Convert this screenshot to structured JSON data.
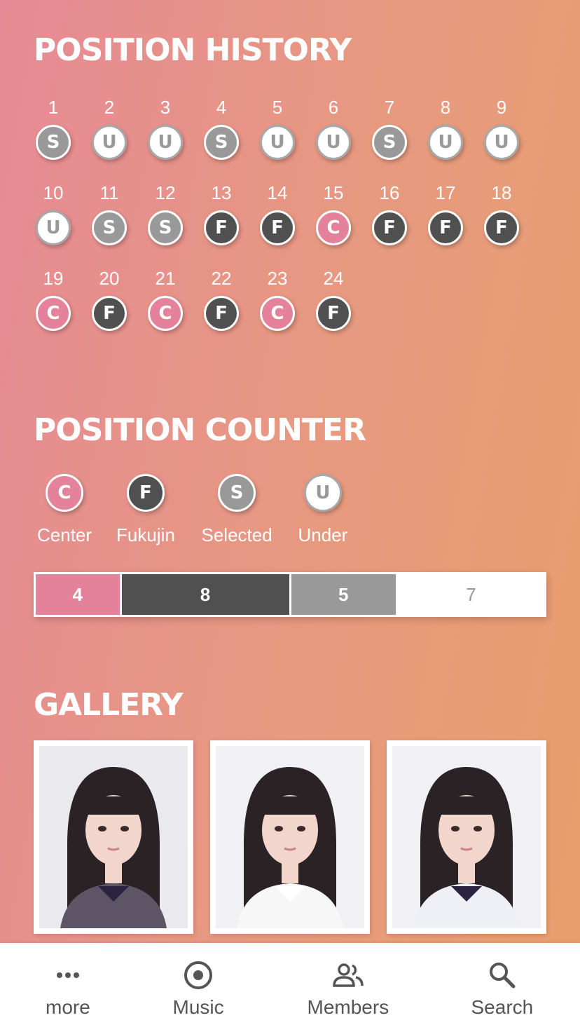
{
  "sections": {
    "history_title": "POSITION HISTORY",
    "counter_title": "POSITION COUNTER",
    "gallery_title": "GALLERY"
  },
  "history": [
    {
      "n": "1",
      "pos": "S"
    },
    {
      "n": "2",
      "pos": "U"
    },
    {
      "n": "3",
      "pos": "U"
    },
    {
      "n": "4",
      "pos": "S"
    },
    {
      "n": "5",
      "pos": "U"
    },
    {
      "n": "6",
      "pos": "U"
    },
    {
      "n": "7",
      "pos": "S"
    },
    {
      "n": "8",
      "pos": "U"
    },
    {
      "n": "9",
      "pos": "U"
    },
    {
      "n": "10",
      "pos": "U"
    },
    {
      "n": "11",
      "pos": "S"
    },
    {
      "n": "12",
      "pos": "S"
    },
    {
      "n": "13",
      "pos": "F"
    },
    {
      "n": "14",
      "pos": "F"
    },
    {
      "n": "15",
      "pos": "C"
    },
    {
      "n": "16",
      "pos": "F"
    },
    {
      "n": "17",
      "pos": "F"
    },
    {
      "n": "18",
      "pos": "F"
    },
    {
      "n": "19",
      "pos": "C"
    },
    {
      "n": "20",
      "pos": "F"
    },
    {
      "n": "21",
      "pos": "C"
    },
    {
      "n": "22",
      "pos": "F"
    },
    {
      "n": "23",
      "pos": "C"
    },
    {
      "n": "24",
      "pos": "F"
    }
  ],
  "legend": [
    {
      "code": "C",
      "label": "Center"
    },
    {
      "code": "F",
      "label": "Fukujin"
    },
    {
      "code": "S",
      "label": "Selected"
    },
    {
      "code": "U",
      "label": "Under"
    }
  ],
  "counter": [
    {
      "code": "C",
      "value": "4"
    },
    {
      "code": "F",
      "value": "8"
    },
    {
      "code": "S",
      "value": "5"
    },
    {
      "code": "U",
      "value": "7"
    }
  ],
  "colors": {
    "center": "#e5829b",
    "fukujin": "#505050",
    "selected": "#999999",
    "under": "#ffffff"
  },
  "gallery": [
    {
      "icon": "photo-icon"
    },
    {
      "icon": "photo-icon"
    },
    {
      "icon": "photo-icon"
    }
  ],
  "tabs": [
    {
      "label": "more",
      "icon": "more-icon"
    },
    {
      "label": "Music",
      "icon": "music-disc-icon"
    },
    {
      "label": "Members",
      "icon": "members-icon"
    },
    {
      "label": "Search",
      "icon": "search-icon"
    }
  ]
}
